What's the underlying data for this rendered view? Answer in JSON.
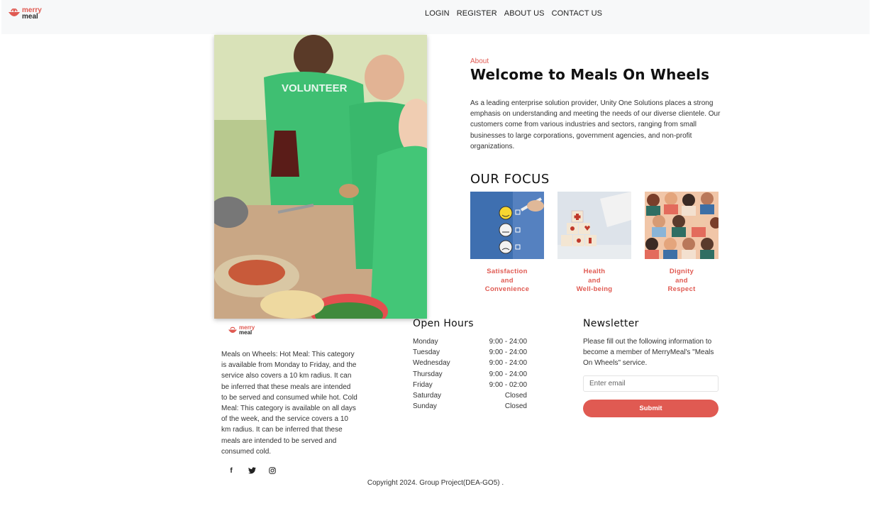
{
  "brand": {
    "line1": "merry",
    "line2": "meal"
  },
  "nav": {
    "items": [
      "LOGIN",
      "REGISTER",
      "ABOUT US",
      "CONTACT US"
    ]
  },
  "hero": {
    "image_alt": "Volunteers serving food",
    "shirt_text": "VOLUNTEER"
  },
  "about": {
    "kicker": "About",
    "title": "Welcome to Meals On Wheels",
    "body": "As a leading enterprise solution provider, Unity One Solutions places a strong emphasis on understanding and meeting the needs of our diverse clientele. Our customers come from various industries and sectors, ranging from small businesses to large corporations, government agencies, and non-profit organizations."
  },
  "focus": {
    "title": "OUR FOCUS",
    "cards": [
      {
        "icon": "satisfaction-faces-icon",
        "lines": [
          "Satisfaction",
          "and",
          "Convenience"
        ]
      },
      {
        "icon": "health-blocks-icon",
        "lines": [
          "Health",
          "and",
          "Well-being"
        ]
      },
      {
        "icon": "diverse-people-icon",
        "lines": [
          "Dignity",
          "and",
          "Respect"
        ]
      }
    ]
  },
  "footer": {
    "description": "Meals on Wheels: Hot Meal: This category is available from Monday to Friday, and the service also covers a 10 km radius. It can be inferred that these meals are intended to be served and consumed while hot. Cold Meal: This category is available on all days of the week, and the service covers a 10 km radius. It can be inferred that these meals are intended to be served and consumed cold.",
    "social": [
      {
        "icon": "facebook-icon",
        "glyph": "f"
      },
      {
        "icon": "twitter-icon",
        "glyph": "🐦"
      },
      {
        "icon": "instagram-icon",
        "glyph": "◎"
      }
    ],
    "hours_title": "Open Hours",
    "hours": [
      {
        "day": "Monday",
        "time": "9:00 - 24:00"
      },
      {
        "day": "Tuesday",
        "time": "9:00 - 24:00"
      },
      {
        "day": "Wednesday",
        "time": "9:00 - 24:00"
      },
      {
        "day": "Thursday",
        "time": "9:00 - 24:00"
      },
      {
        "day": "Friday",
        "time": "9:00 - 02:00"
      },
      {
        "day": "Saturday",
        "time": "Closed"
      },
      {
        "day": "Sunday",
        "time": "Closed"
      }
    ],
    "newsletter_title": "Newsletter",
    "newsletter_body": "Please fill out the following information to become a member of MerryMeal's \"Meals On Wheels\" service.",
    "email_placeholder": "Enter email",
    "email_value": "",
    "submit_label": "Submit",
    "copyright": "Copyright 2024. Group Project(DEA-GO5) ."
  },
  "colors": {
    "accent": "#e05a52",
    "navbar_bg": "#f7f8f9"
  }
}
